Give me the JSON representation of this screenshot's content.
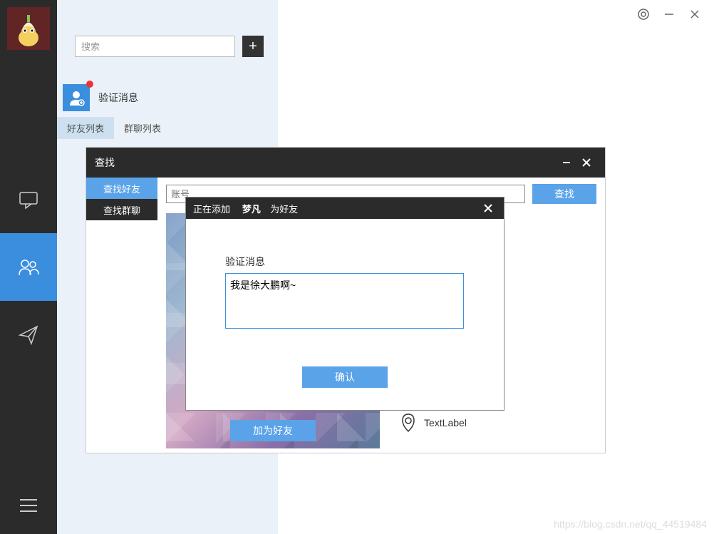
{
  "sidebar": {
    "nav": [
      "chat",
      "contacts",
      "send"
    ]
  },
  "contactPanel": {
    "searchPlaceholder": "搜索",
    "verifyLabel": "验证消息",
    "tabs": [
      "好友列表",
      "群聊列表"
    ]
  },
  "topControls": {
    "settings": "settings",
    "minimize": "minimize",
    "close": "close"
  },
  "searchDialog": {
    "title": "查找",
    "sideTabs": [
      "查找好友",
      "查找群聊"
    ],
    "accountPlaceholder": "账号",
    "searchBtn": "查找",
    "addFriendBtn": "加为好友",
    "resultLocation": "TextLabel"
  },
  "modal": {
    "titlePrefix": "正在添加",
    "titleName": "梦凡",
    "titleSuffix": "为好友",
    "label": "验证消息",
    "textValue": "我是徐大鹏啊~",
    "confirmBtn": "确认"
  },
  "watermark": "https://blog.csdn.net/qq_44519484"
}
